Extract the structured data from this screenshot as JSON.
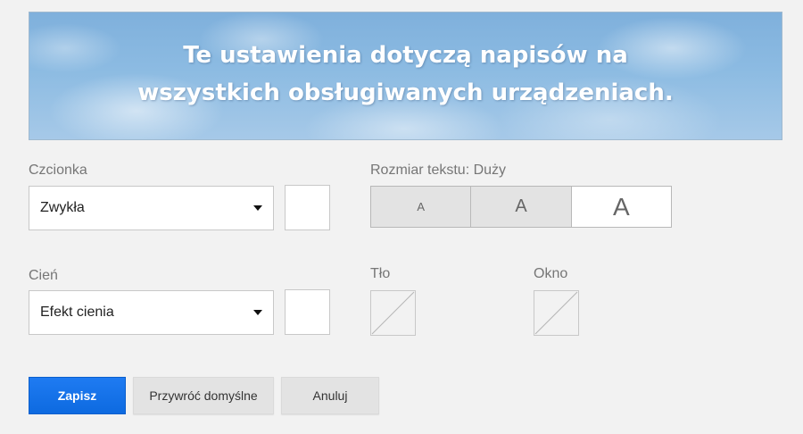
{
  "banner": {
    "text": "Te ustawienia dotyczą napisów na wszystkich obsługiwanych urządzeniach."
  },
  "font": {
    "label": "Czcionka",
    "value": "Zwykła",
    "color": "#ffffff"
  },
  "text_size": {
    "label": "Rozmiar tekstu: Duży",
    "options": [
      "A",
      "A",
      "A"
    ],
    "selected_index": 2
  },
  "shadow": {
    "label": "Cień",
    "value": "Efekt cienia",
    "color": "#ffffff"
  },
  "background": {
    "label": "Tło",
    "color": "none"
  },
  "window": {
    "label": "Okno",
    "color": "none"
  },
  "actions": {
    "save": "Zapisz",
    "restore_defaults": "Przywróć domyślne",
    "cancel": "Anuluj"
  },
  "colors": {
    "primary": "#1a73e8",
    "page_background": "#f2f2f2",
    "label_text": "#767676"
  },
  "icons": {
    "dropdown": "chevron-down-icon",
    "no_color": "no-color-icon"
  }
}
